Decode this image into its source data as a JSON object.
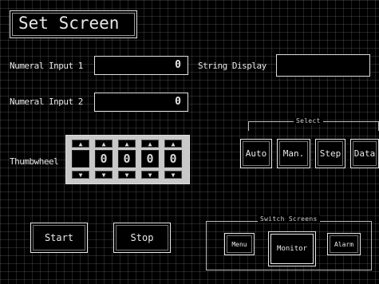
{
  "title": "Set Screen",
  "numeral_input_1": {
    "label": "Numeral Input 1",
    "value": "0"
  },
  "numeral_input_2": {
    "label": "Numeral Input 2",
    "value": "0"
  },
  "string_display": {
    "label": "String Display",
    "value": ""
  },
  "thumbwheel": {
    "label": "Thumbwheel",
    "up": "▲",
    "down": "▼",
    "digits": [
      "",
      "0",
      "0",
      "0",
      "0"
    ]
  },
  "select": {
    "title": "Select",
    "buttons": [
      "Auto",
      "Man.",
      "Step",
      "Data"
    ]
  },
  "start_label": "Start",
  "stop_label": "Stop",
  "switch_screens": {
    "title": "Switch Screens",
    "buttons": [
      "Menu",
      "Monitor",
      "Alarm"
    ]
  }
}
